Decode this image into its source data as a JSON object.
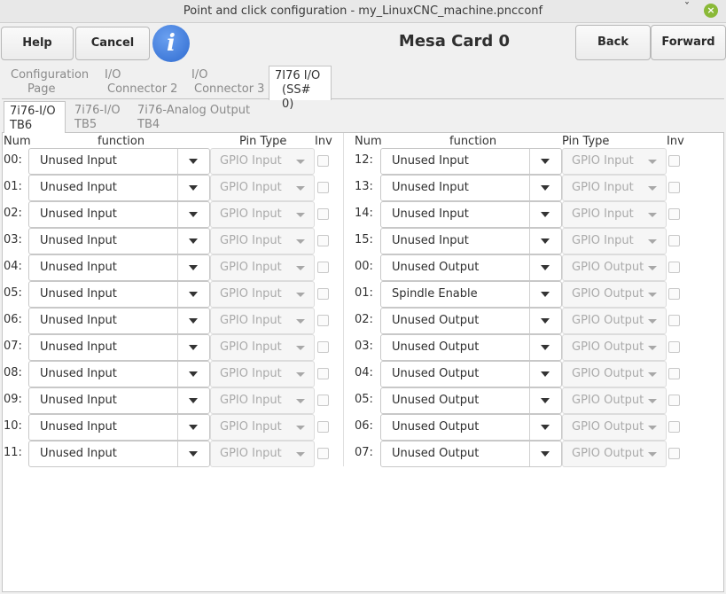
{
  "window": {
    "title": "Point and click configuration - my_LinuxCNC_machine.pncconf",
    "minimize_glyph": "ˇ",
    "close_glyph": "×"
  },
  "toolbar": {
    "help_label": "Help",
    "cancel_label": "Cancel",
    "info_glyph": "i",
    "title": "Mesa Card 0",
    "back_label": "Back",
    "forward_label": "Forward"
  },
  "tabs": [
    {
      "line1": "Configuration",
      "line2": "Page"
    },
    {
      "line1": "I/O",
      "line2": "Connector 2"
    },
    {
      "line1": "I/O",
      "line2": "Connector 3"
    },
    {
      "line1": "7I76 I/O",
      "line2": "(SS# 0)"
    }
  ],
  "subtabs": [
    {
      "line1": "7i76-I/O",
      "line2": "TB6"
    },
    {
      "line1": "7i76-I/O",
      "line2": "TB5"
    },
    {
      "line1": "7i76-Analog Output",
      "line2": "TB4"
    }
  ],
  "headers": {
    "num": "Num",
    "function": "function",
    "pin_type": "Pin Type",
    "inv": "Inv"
  },
  "left_rows": [
    {
      "num": "00:",
      "function": "Unused Input",
      "pin_type": "GPIO Input"
    },
    {
      "num": "01:",
      "function": "Unused Input",
      "pin_type": "GPIO Input"
    },
    {
      "num": "02:",
      "function": "Unused Input",
      "pin_type": "GPIO Input"
    },
    {
      "num": "03:",
      "function": "Unused Input",
      "pin_type": "GPIO Input"
    },
    {
      "num": "04:",
      "function": "Unused Input",
      "pin_type": "GPIO Input"
    },
    {
      "num": "05:",
      "function": "Unused Input",
      "pin_type": "GPIO Input"
    },
    {
      "num": "06:",
      "function": "Unused Input",
      "pin_type": "GPIO Input"
    },
    {
      "num": "07:",
      "function": "Unused Input",
      "pin_type": "GPIO Input"
    },
    {
      "num": "08:",
      "function": "Unused Input",
      "pin_type": "GPIO Input"
    },
    {
      "num": "09:",
      "function": "Unused Input",
      "pin_type": "GPIO Input"
    },
    {
      "num": "10:",
      "function": "Unused Input",
      "pin_type": "GPIO Input"
    },
    {
      "num": "11:",
      "function": "Unused Input",
      "pin_type": "GPIO Input"
    }
  ],
  "right_rows": [
    {
      "num": "12:",
      "function": "Unused Input",
      "pin_type": "GPIO Input"
    },
    {
      "num": "13:",
      "function": "Unused Input",
      "pin_type": "GPIO Input"
    },
    {
      "num": "14:",
      "function": "Unused Input",
      "pin_type": "GPIO Input"
    },
    {
      "num": "15:",
      "function": "Unused Input",
      "pin_type": "GPIO Input"
    },
    {
      "num": "00:",
      "function": "Unused Output",
      "pin_type": "GPIO Output"
    },
    {
      "num": "01:",
      "function": "Spindle Enable",
      "pin_type": "GPIO Output"
    },
    {
      "num": "02:",
      "function": "Unused Output",
      "pin_type": "GPIO Output"
    },
    {
      "num": "03:",
      "function": "Unused Output",
      "pin_type": "GPIO Output"
    },
    {
      "num": "04:",
      "function": "Unused Output",
      "pin_type": "GPIO Output"
    },
    {
      "num": "05:",
      "function": "Unused Output",
      "pin_type": "GPIO Output"
    },
    {
      "num": "06:",
      "function": "Unused Output",
      "pin_type": "GPIO Output"
    },
    {
      "num": "07:",
      "function": "Unused Output",
      "pin_type": "GPIO Output"
    }
  ]
}
